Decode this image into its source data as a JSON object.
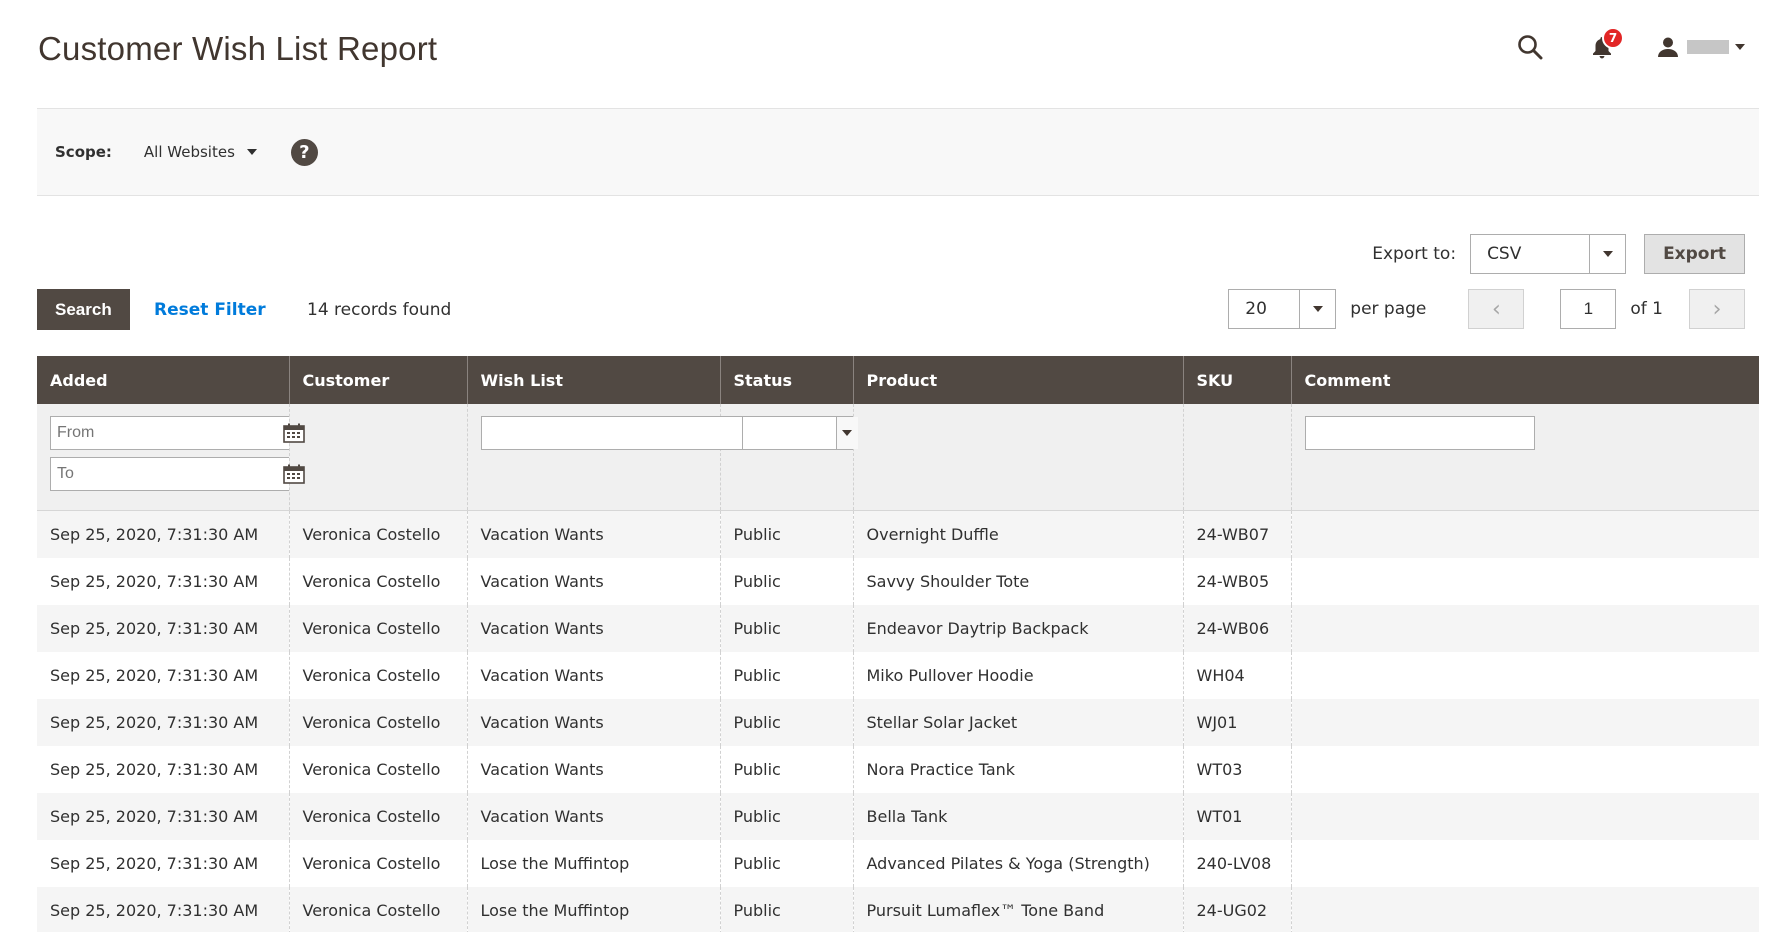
{
  "header": {
    "title": "Customer Wish List Report",
    "notification_count": "7"
  },
  "scope": {
    "label": "Scope:",
    "value": "All Websites",
    "help": "?"
  },
  "export": {
    "label": "Export to:",
    "format": "CSV",
    "button": "Export"
  },
  "actions": {
    "search": "Search",
    "reset": "Reset Filter",
    "records_found": "14 records found"
  },
  "pager": {
    "per_page_value": "20",
    "per_page_label": "per page",
    "current_page": "1",
    "of_label": "of 1",
    "prev": "‹",
    "next": "›"
  },
  "grid": {
    "columns": [
      "Added",
      "Customer",
      "Wish List",
      "Status",
      "Product",
      "SKU",
      "Comment"
    ],
    "filters": {
      "from_placeholder": "From",
      "to_placeholder": "To"
    },
    "rows": [
      [
        "Sep 25, 2020, 7:31:30 AM",
        "Veronica Costello",
        "Vacation Wants",
        "Public",
        "Overnight Duffle",
        "24-WB07",
        ""
      ],
      [
        "Sep 25, 2020, 7:31:30 AM",
        "Veronica Costello",
        "Vacation Wants",
        "Public",
        "Savvy Shoulder Tote",
        "24-WB05",
        ""
      ],
      [
        "Sep 25, 2020, 7:31:30 AM",
        "Veronica Costello",
        "Vacation Wants",
        "Public",
        "Endeavor Daytrip Backpack",
        "24-WB06",
        ""
      ],
      [
        "Sep 25, 2020, 7:31:30 AM",
        "Veronica Costello",
        "Vacation Wants",
        "Public",
        "Miko Pullover Hoodie",
        "WH04",
        ""
      ],
      [
        "Sep 25, 2020, 7:31:30 AM",
        "Veronica Costello",
        "Vacation Wants",
        "Public",
        "Stellar Solar Jacket",
        "WJ01",
        ""
      ],
      [
        "Sep 25, 2020, 7:31:30 AM",
        "Veronica Costello",
        "Vacation Wants",
        "Public",
        "Nora Practice Tank",
        "WT03",
        ""
      ],
      [
        "Sep 25, 2020, 7:31:30 AM",
        "Veronica Costello",
        "Vacation Wants",
        "Public",
        "Bella Tank",
        "WT01",
        ""
      ],
      [
        "Sep 25, 2020, 7:31:30 AM",
        "Veronica Costello",
        "Lose the Muffintop",
        "Public",
        "Advanced Pilates & Yoga (Strength)",
        "240-LV08",
        ""
      ],
      [
        "Sep 25, 2020, 7:31:30 AM",
        "Veronica Costello",
        "Lose the Muffintop",
        "Public",
        "Pursuit Lumaflex™ Tone Band",
        "24-UG02",
        ""
      ]
    ]
  },
  "icons": {
    "search": "search-icon",
    "notifications": "bell-icon",
    "user": "user-icon",
    "calendar": "calendar-icon"
  },
  "colors": {
    "header_bg": "#514943",
    "link": "#007bdb",
    "badge": "#e22626"
  }
}
